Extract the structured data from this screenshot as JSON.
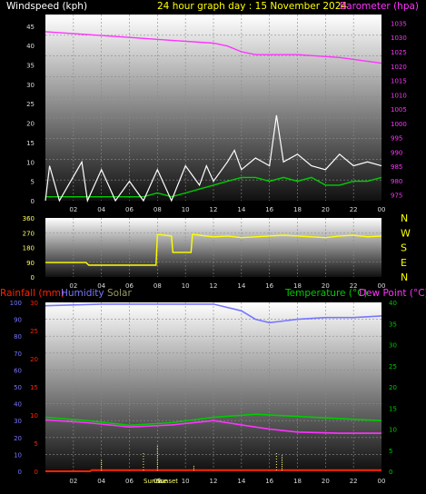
{
  "header": {
    "windspeed_label": "Windspeed (kph)",
    "title": "24 hour graph day : 15 November 2024",
    "barometer_label": "Barometer (hpa)"
  },
  "bottom_header": {
    "rainfall_label": "Rainfall (mm)",
    "humidity_label": "Humidity",
    "solar_label": "Solar",
    "temperature_label": "Temperature (°C)",
    "dewpoint_label": "Dew Point (°C)"
  },
  "events": {
    "sunrise_label": "Sunrise",
    "sunset_label": "Sunset"
  },
  "colors": {
    "wind": "#ffffff",
    "gust": "#00cc00",
    "barometer": "#ff33ff",
    "direction": "#ffff00",
    "rain": "#ff2200",
    "humidity": "#7777ff",
    "solar": "#ffff66",
    "temperature": "#00cc00",
    "dewpoint": "#ff33ff",
    "title": "#ffff00",
    "wind_label": "#ffffff"
  },
  "chart_data": [
    {
      "type": "line",
      "name": "wind-barometer",
      "x": [
        "02",
        "04",
        "06",
        "08",
        "10",
        "12",
        "14",
        "16",
        "18",
        "20",
        "22",
        "00"
      ],
      "yleft": {
        "ticks": [
          "0",
          "5",
          "10",
          "15",
          "20",
          "25",
          "30",
          "35",
          "40",
          "45"
        ],
        "ylim": [
          0,
          48
        ]
      },
      "yright": {
        "ticks": [
          "975",
          "980",
          "985",
          "990",
          "995",
          "1000",
          "1005",
          "1010",
          "1015",
          "1020",
          "1025",
          "1030",
          "1035"
        ],
        "ylim": [
          973,
          1038
        ]
      },
      "series": [
        {
          "key": "barometer",
          "axis": "right",
          "hours": [
            0,
            3,
            6,
            9,
            12,
            13,
            14,
            15,
            18,
            21,
            24
          ],
          "values": [
            1032,
            1031,
            1030,
            1029,
            1028,
            1027,
            1025,
            1024,
            1024,
            1023,
            1021
          ]
        },
        {
          "key": "wind_mean",
          "axis": "left",
          "hours": [
            0,
            2,
            4,
            6,
            7,
            8,
            9,
            10,
            11,
            12,
            13,
            14,
            15,
            16,
            17,
            18,
            19,
            20,
            21,
            22,
            23,
            24
          ],
          "values": [
            1,
            1,
            1,
            1,
            1,
            2,
            1,
            2,
            3,
            4,
            5,
            6,
            6,
            5,
            6,
            5,
            6,
            4,
            4,
            5,
            5,
            6
          ]
        },
        {
          "key": "wind_gust",
          "axis": "left",
          "hours": [
            0,
            0.3,
            1,
            2.6,
            3,
            4,
            5,
            6,
            7,
            8,
            9,
            10,
            11,
            11.5,
            12,
            13,
            13.5,
            14,
            15,
            16,
            16.5,
            17,
            18,
            19,
            20,
            21,
            22,
            23,
            24
          ],
          "values": [
            0,
            9,
            0,
            10,
            0,
            8,
            0,
            5,
            0,
            8,
            0,
            9,
            4,
            9,
            5,
            10,
            13,
            8,
            11,
            9,
            22,
            10,
            12,
            9,
            8,
            12,
            9,
            10,
            9
          ]
        }
      ]
    },
    {
      "type": "line",
      "name": "wind-direction",
      "x": [
        "02",
        "04",
        "06",
        "08",
        "10",
        "12",
        "14",
        "16",
        "18",
        "20",
        "22",
        "00"
      ],
      "y": {
        "ticks": [
          "0",
          "90",
          "180",
          "270",
          "360"
        ],
        "ylim": [
          0,
          360
        ]
      },
      "direction_labels": [
        "N",
        "W",
        "S",
        "E",
        "N"
      ],
      "series": [
        {
          "key": "direction",
          "hours": [
            0,
            2.9,
            3.1,
            7.9,
            8.0,
            9.0,
            9.1,
            10.4,
            10.5,
            11,
            12,
            13,
            14,
            15,
            16,
            17,
            18,
            19,
            20,
            21,
            22,
            23,
            24
          ],
          "values": [
            88,
            88,
            72,
            72,
            260,
            250,
            150,
            150,
            260,
            255,
            245,
            250,
            240,
            245,
            250,
            255,
            250,
            245,
            240,
            250,
            255,
            245,
            250
          ]
        }
      ]
    },
    {
      "type": "line",
      "name": "temp-humidity-rain",
      "x": [
        "02",
        "04",
        "06",
        "08",
        "10",
        "12",
        "14",
        "16",
        "18",
        "20",
        "22",
        "00"
      ],
      "yleft": {
        "ticks": [
          "0",
          "10",
          "20",
          "30",
          "40",
          "50",
          "60",
          "70",
          "80",
          "90",
          "100"
        ],
        "ylim": [
          0,
          100
        ]
      },
      "yrain": {
        "ticks": [
          "0",
          "5",
          "10",
          "15",
          "20",
          "25",
          "30"
        ],
        "ylim": [
          0,
          30
        ]
      },
      "yright": {
        "ticks": [
          "0",
          "5",
          "10",
          "15",
          "20",
          "25",
          "30",
          "35",
          "40"
        ],
        "ylim": [
          0,
          40
        ]
      },
      "series": [
        {
          "key": "humidity",
          "axis": "left",
          "hours": [
            0,
            4,
            8,
            12,
            14,
            15,
            16,
            17,
            18,
            20,
            22,
            24
          ],
          "values": [
            98,
            99,
            99,
            99,
            95,
            90,
            88,
            89,
            90,
            91,
            91,
            92
          ]
        },
        {
          "key": "temperature",
          "axis": "right",
          "hours": [
            0,
            3,
            6,
            9,
            12,
            15,
            18,
            21,
            24
          ],
          "values": [
            12.8,
            12,
            10.9,
            11.5,
            12.8,
            13.5,
            13,
            12.5,
            12
          ]
        },
        {
          "key": "dewpoint",
          "axis": "right",
          "hours": [
            0,
            3,
            6,
            9,
            12,
            14,
            16,
            18,
            21,
            24
          ],
          "values": [
            12.2,
            11.5,
            10.5,
            11,
            12,
            11,
            10,
            9.3,
            9,
            9
          ]
        },
        {
          "key": "rain",
          "axis": "rain",
          "hours": [
            0,
            3.2,
            3.3,
            24
          ],
          "values": [
            0,
            0,
            0.2,
            0.2
          ]
        },
        {
          "key": "solar",
          "axis": "left",
          "hours": [
            4,
            8,
            10.6,
            16.9
          ],
          "values": [
            4,
            10,
            2,
            6
          ]
        }
      ],
      "sunrise_hour": 7.0,
      "sunset_hour": 16.5
    }
  ]
}
